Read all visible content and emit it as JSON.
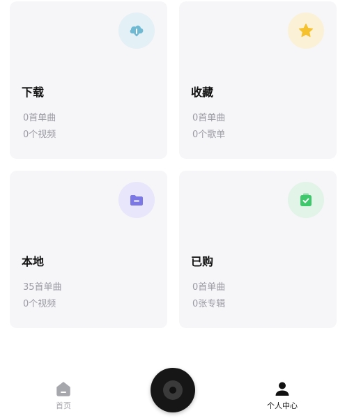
{
  "cards": [
    {
      "title": "下载",
      "line1": "0首单曲",
      "line2": "0个视频",
      "icon": "cloud-download-icon",
      "badge_bg": "#e3f0f6",
      "icon_color": "#6fb9d2"
    },
    {
      "title": "收藏",
      "line1": "0首单曲",
      "line2": "0个歌单",
      "icon": "star-icon",
      "badge_bg": "#fbf1d7",
      "icon_color": "#f6c12e"
    },
    {
      "title": "本地",
      "line1": "35首单曲",
      "line2": "0个视频",
      "icon": "folder-icon",
      "badge_bg": "#e7e6fb",
      "icon_color": "#7b78e6"
    },
    {
      "title": "已购",
      "line1": "0首单曲",
      "line2": "0张专辑",
      "icon": "shopping-bag-icon",
      "badge_bg": "#e2f3e7",
      "icon_color": "#3fc76b"
    }
  ],
  "nav": {
    "home_label": "首页",
    "me_label": "个人中心",
    "home_icon": "home-icon",
    "player_icon": "vinyl-disc-icon",
    "me_icon": "user-icon",
    "inactive_color": "#a6a6ad",
    "active_color": "#111111"
  }
}
